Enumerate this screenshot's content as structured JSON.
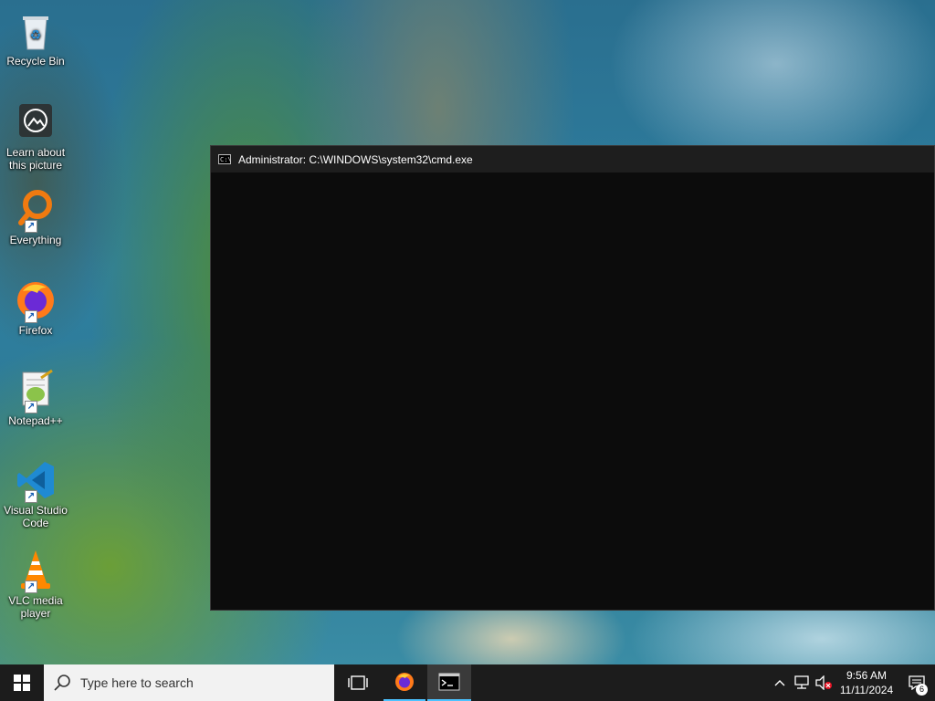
{
  "desktop": {
    "icons": [
      {
        "label": "Recycle Bin",
        "icon": "recycle-bin-icon"
      },
      {
        "label": "Learn about this picture",
        "icon": "learn-picture-icon"
      },
      {
        "label": "Everything",
        "icon": "everything-search-icon"
      },
      {
        "label": "Firefox",
        "icon": "firefox-icon"
      },
      {
        "label": "Notepad++",
        "icon": "notepad-plus-plus-icon"
      },
      {
        "label": "Visual Studio Code",
        "icon": "vscode-icon"
      },
      {
        "label": "VLC media player",
        "icon": "vlc-icon"
      }
    ]
  },
  "window": {
    "title": "Administrator: C:\\WINDOWS\\system32\\cmd.exe",
    "icon_text": "C:\\",
    "background": "#0c0c0c"
  },
  "taskbar": {
    "search_placeholder": "Type here to search",
    "clock_time": "9:56 AM",
    "clock_date": "11/11/2024",
    "notification_count": "6",
    "accent": "#4cc2ff"
  }
}
